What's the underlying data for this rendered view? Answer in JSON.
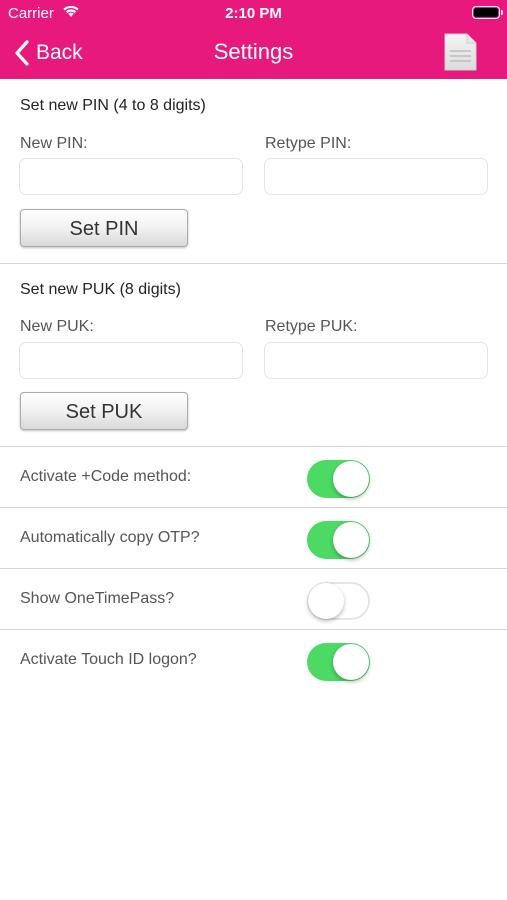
{
  "status_bar": {
    "carrier": "Carrier",
    "time": "2:10 PM"
  },
  "nav": {
    "back_label": "Back",
    "title": "Settings",
    "right_icon": "document-icon"
  },
  "pin_section": {
    "title": "Set new PIN  (4 to 8 digits)",
    "new_label": "New PIN:",
    "retype_label": "Retype PIN:",
    "new_value": "",
    "retype_value": "",
    "button_label": "Set PIN"
  },
  "puk_section": {
    "title": "Set new PUK (8 digits)",
    "new_label": "New PUK:",
    "retype_label": "Retype PUK:",
    "new_value": "",
    "retype_value": "",
    "button_label": "Set PUK"
  },
  "toggles": [
    {
      "label": "Activate +Code method:",
      "on": true
    },
    {
      "label": "Automatically copy OTP?",
      "on": true
    },
    {
      "label": "Show OneTimePass?",
      "on": false
    },
    {
      "label": "Activate Touch ID logon?",
      "on": true
    }
  ],
  "colors": {
    "brand": "#e7197d",
    "toggle_on": "#4cd964"
  }
}
